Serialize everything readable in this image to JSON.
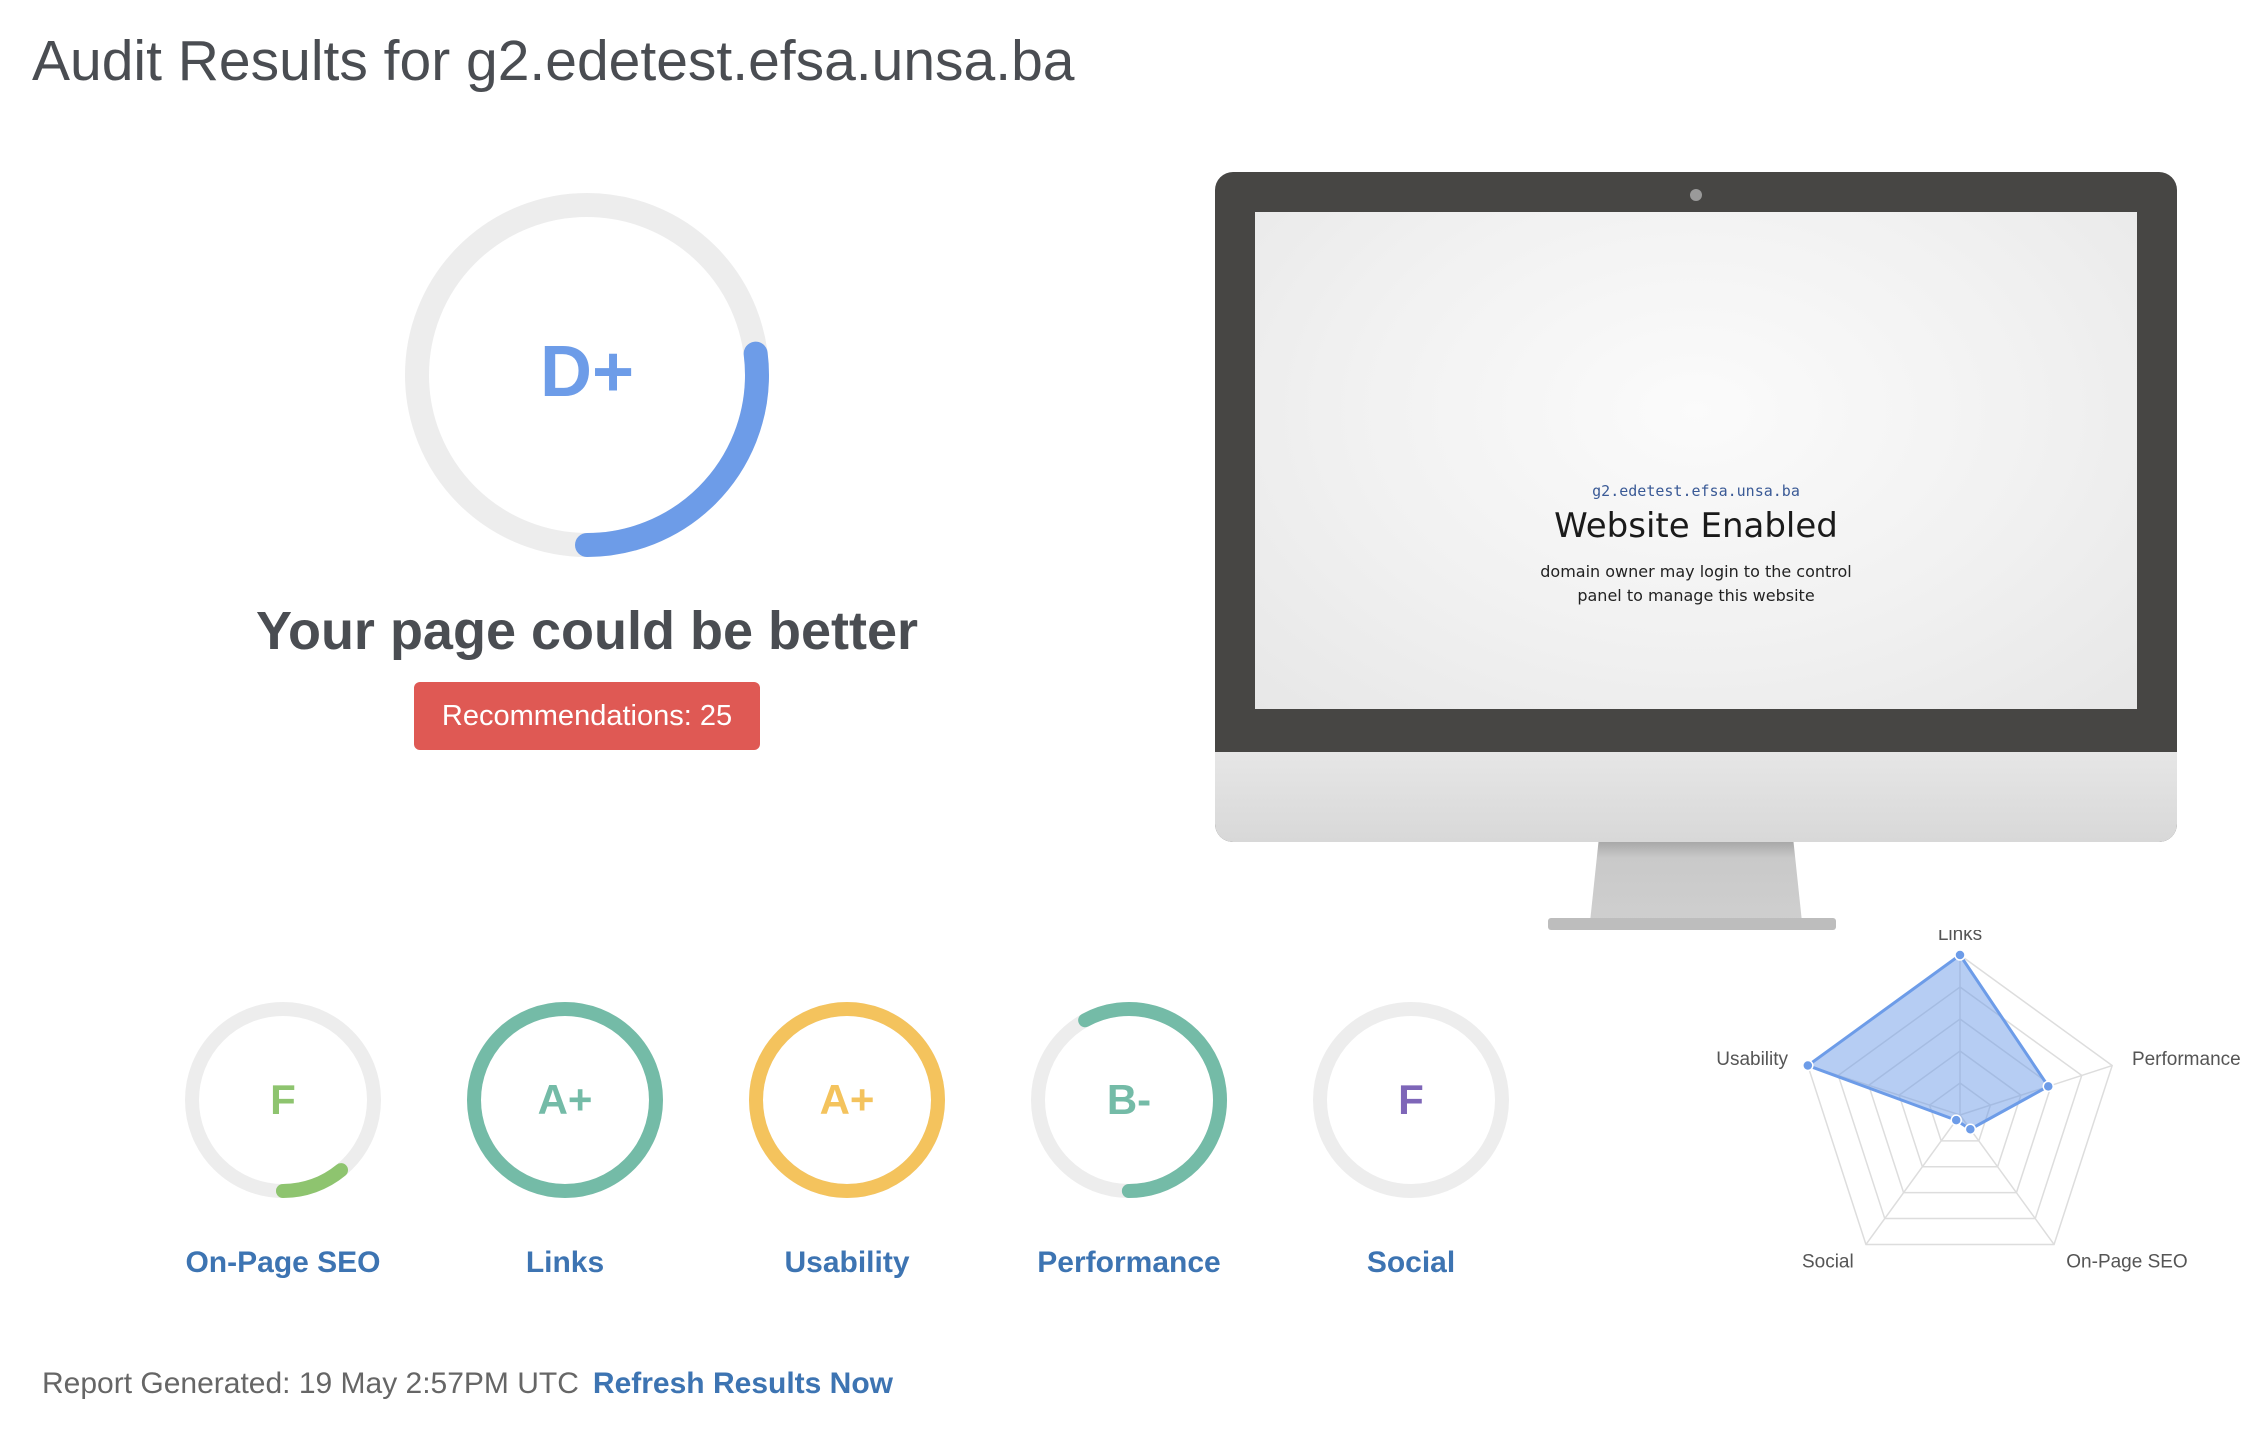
{
  "page": {
    "title": "Audit Results for g2.edetest.efsa.unsa.ba"
  },
  "overall": {
    "grade": "D+",
    "score_fraction": 0.27,
    "color": "#6d9ce8",
    "track_color": "#ededed",
    "heading": "Your page could be better",
    "recommendations_label": "Recommendations: 25",
    "recommendations_color": "#df5954"
  },
  "preview": {
    "site_url": "g2.edetest.efsa.unsa.ba",
    "site_title": "Website Enabled",
    "site_description": "domain owner may login to the control panel to manage this website"
  },
  "categories": [
    {
      "label": "On-Page SEO",
      "grade": "F",
      "score_fraction": 0.11,
      "color": "#8ec46f",
      "grade_color": "#8ec46f"
    },
    {
      "label": "Links",
      "grade": "A+",
      "score_fraction": 1.0,
      "color": "#74bba7",
      "grade_color": "#74bba7"
    },
    {
      "label": "Usability",
      "grade": "A+",
      "score_fraction": 1.0,
      "color": "#f4c35d",
      "grade_color": "#f4c35d"
    },
    {
      "label": "Performance",
      "grade": "B-",
      "score_fraction": 0.58,
      "color": "#74bba7",
      "grade_color": "#74bba7"
    },
    {
      "label": "Social",
      "grade": "F",
      "score_fraction": 0.0,
      "color": "#7e66b8",
      "grade_color": "#7e66b8"
    }
  ],
  "chart_data": {
    "type": "radar",
    "axes": [
      "Links",
      "Performance",
      "On-Page SEO",
      "Social",
      "Usability"
    ],
    "values": [
      100,
      58,
      11,
      0,
      100
    ],
    "range": [
      0,
      100
    ],
    "grid_levels": 5,
    "fill_color": "#6d9ce8"
  },
  "footer": {
    "report_generated": "Report Generated: 19 May 2:57PM UTC",
    "refresh_label": "Refresh Results Now"
  }
}
